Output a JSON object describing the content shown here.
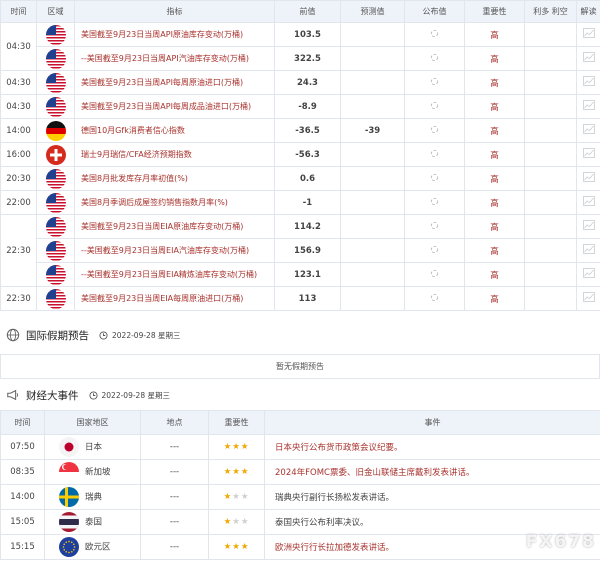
{
  "calendar": {
    "headers": [
      "时间",
      "区域",
      "指标",
      "前值",
      "预测值",
      "公布值",
      "重要性",
      "利多 利空",
      "解读"
    ],
    "rows": [
      {
        "time": "04:30",
        "flag": "us",
        "indicator": "美国截至9月23日当周API原油库存变动(万桶)",
        "prev": "103.5",
        "forecast": "",
        "actual": "",
        "importance": "高"
      },
      {
        "time": "",
        "flag": "us",
        "indicator": "--美国截至9月23日当周API汽油库存变动(万桶)",
        "prev": "322.5",
        "forecast": "",
        "actual": "",
        "importance": "高"
      },
      {
        "time": "04:30",
        "flag": "us",
        "indicator": "美国截至9月23日当周API每周原油进口(万桶)",
        "prev": "24.3",
        "forecast": "",
        "actual": "",
        "importance": "高"
      },
      {
        "time": "04:30",
        "flag": "us",
        "indicator": "美国截至9月23日当周API每周成品油进口(万桶)",
        "prev": "-8.9",
        "forecast": "",
        "actual": "",
        "importance": "高"
      },
      {
        "time": "14:00",
        "flag": "de",
        "indicator": "德国10月Gfk消费者信心指数",
        "prev": "-36.5",
        "forecast": "-39",
        "actual": "",
        "importance": "高"
      },
      {
        "time": "16:00",
        "flag": "ch",
        "indicator": "瑞士9月瑞信/CFA经济预期指数",
        "prev": "-56.3",
        "forecast": "",
        "actual": "",
        "importance": "高"
      },
      {
        "time": "20:30",
        "flag": "us",
        "indicator": "美国8月批发库存月率初值(%)",
        "prev": "0.6",
        "forecast": "",
        "actual": "",
        "importance": "高"
      },
      {
        "time": "22:00",
        "flag": "us",
        "indicator": "美国8月季调后成屋签约销售指数月率(%)",
        "prev": "-1",
        "forecast": "",
        "actual": "",
        "importance": "高"
      },
      {
        "time": "",
        "flag": "us",
        "indicator": "美国截至9月23日当周EIA原油库存变动(万桶)",
        "prev": "114.2",
        "forecast": "",
        "actual": "",
        "importance": "高"
      },
      {
        "time": "22:30",
        "flag": "us",
        "indicator": "--美国截至9月23日当周EIA汽油库存变动(万桶)",
        "prev": "156.9",
        "forecast": "",
        "actual": "",
        "importance": "高"
      },
      {
        "time": "",
        "flag": "us",
        "indicator": "--美国截至9月23日当周EIA精炼油库存变动(万桶)",
        "prev": "123.1",
        "forecast": "",
        "actual": "",
        "importance": "高"
      },
      {
        "time": "22:30",
        "flag": "us",
        "indicator": "美国截至9月23日当周EIA每周原油进口(万桶)",
        "prev": "113",
        "forecast": "",
        "actual": "",
        "importance": "高"
      }
    ]
  },
  "holidays": {
    "title": "国际假期预告",
    "date": "2022-09-28 星期三",
    "empty_text": "暂无假期预告",
    "icon": "globe-icon"
  },
  "events": {
    "title": "财经大事件",
    "date": "2022-09-28 星期三",
    "icon": "megaphone-icon",
    "headers": [
      "时间",
      "国家地区",
      "地点",
      "重要性",
      "事件"
    ],
    "rows": [
      {
        "time": "07:50",
        "flag": "jp",
        "region": "日本",
        "place": "---",
        "stars": 3,
        "event": "日本央行公布货币政策会议纪要。",
        "red": true
      },
      {
        "time": "08:35",
        "flag": "sg",
        "region": "新加坡",
        "place": "---",
        "stars": 3,
        "event": "2024年FOMC票委、旧金山联储主席戴利发表讲话。",
        "red": true
      },
      {
        "time": "14:00",
        "flag": "se",
        "region": "瑞典",
        "place": "---",
        "stars": 1,
        "event": "瑞典央行副行长扬松发表讲话。",
        "red": false
      },
      {
        "time": "15:05",
        "flag": "th",
        "region": "泰国",
        "place": "---",
        "stars": 1,
        "event": "泰国央行公布利率决议。",
        "red": false
      },
      {
        "time": "15:15",
        "flag": "eu",
        "region": "欧元区",
        "place": "---",
        "stars": 3,
        "event": "欧洲央行行长拉加德发表讲话。",
        "red": true
      }
    ]
  },
  "watermark": "FX678",
  "colors": {
    "red_text": "#a8322d",
    "header_bg": "#eef3f9",
    "star": "#f0a800"
  }
}
